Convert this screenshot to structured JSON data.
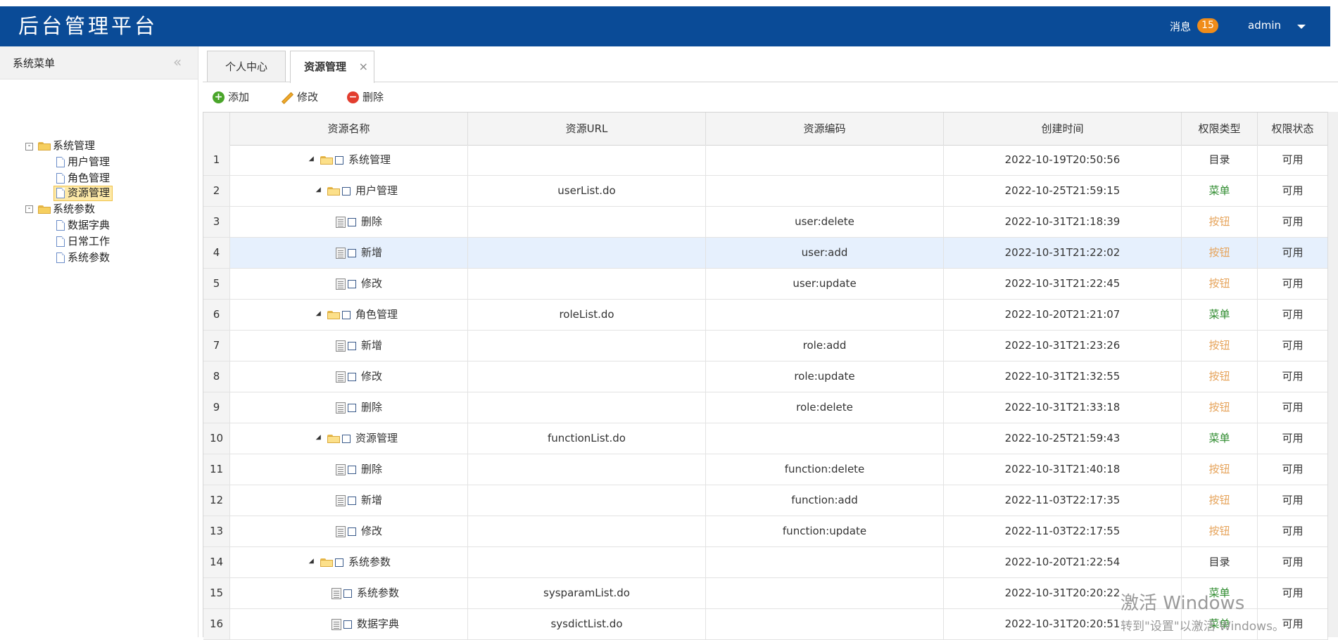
{
  "header": {
    "app_title": "后台管理平台",
    "messages_label": "消息",
    "messages_count": "15",
    "user_name": "admin"
  },
  "sidebar": {
    "title": "系统菜单",
    "tree": [
      {
        "label": "系统管理",
        "children": [
          "用户管理",
          "角色管理",
          "资源管理"
        ]
      },
      {
        "label": "系统参数",
        "children": [
          "数据字典",
          "日常工作",
          "系统参数"
        ]
      }
    ],
    "selected": "资源管理"
  },
  "tabs": [
    {
      "label": "个人中心"
    },
    {
      "label": "资源管理",
      "active": true
    }
  ],
  "toolbar": {
    "add": "添加",
    "edit": "修改",
    "delete": "删除"
  },
  "table": {
    "headers": [
      "资源名称",
      "资源URL",
      "资源编码",
      "创建时间",
      "权限类型",
      "权限状态"
    ],
    "rows": [
      {
        "n": "1",
        "level": 0,
        "kind": "dir",
        "name": "系统管理",
        "url": "",
        "code": "",
        "time": "2022-10-19T20:50:56",
        "type": "目录",
        "status": "可用"
      },
      {
        "n": "2",
        "level": 1,
        "kind": "dir",
        "name": "用户管理",
        "url": "userList.do",
        "code": "",
        "time": "2022-10-25T21:59:15",
        "type": "菜单",
        "status": "可用"
      },
      {
        "n": "3",
        "level": 2,
        "kind": "leaf",
        "name": "删除",
        "url": "",
        "code": "user:delete",
        "time": "2022-10-31T21:18:39",
        "type": "按钮",
        "status": "可用"
      },
      {
        "n": "4",
        "level": 2,
        "kind": "leaf",
        "name": "新增",
        "url": "",
        "code": "user:add",
        "time": "2022-10-31T21:22:02",
        "type": "按钮",
        "status": "可用"
      },
      {
        "n": "5",
        "level": 2,
        "kind": "leaf",
        "name": "修改",
        "url": "",
        "code": "user:update",
        "time": "2022-10-31T21:22:45",
        "type": "按钮",
        "status": "可用"
      },
      {
        "n": "6",
        "level": 1,
        "kind": "dir",
        "name": "角色管理",
        "url": "roleList.do",
        "code": "",
        "time": "2022-10-20T21:21:07",
        "type": "菜单",
        "status": "可用"
      },
      {
        "n": "7",
        "level": 2,
        "kind": "leaf",
        "name": "新增",
        "url": "",
        "code": "role:add",
        "time": "2022-10-31T21:23:26",
        "type": "按钮",
        "status": "可用"
      },
      {
        "n": "8",
        "level": 2,
        "kind": "leaf",
        "name": "修改",
        "url": "",
        "code": "role:update",
        "time": "2022-10-31T21:32:55",
        "type": "按钮",
        "status": "可用"
      },
      {
        "n": "9",
        "level": 2,
        "kind": "leaf",
        "name": "删除",
        "url": "",
        "code": "role:delete",
        "time": "2022-10-31T21:33:18",
        "type": "按钮",
        "status": "可用"
      },
      {
        "n": "10",
        "level": 1,
        "kind": "dir",
        "name": "资源管理",
        "url": "functionList.do",
        "code": "",
        "time": "2022-10-25T21:59:43",
        "type": "菜单",
        "status": "可用"
      },
      {
        "n": "11",
        "level": 2,
        "kind": "leaf",
        "name": "删除",
        "url": "",
        "code": "function:delete",
        "time": "2022-10-31T21:40:18",
        "type": "按钮",
        "status": "可用"
      },
      {
        "n": "12",
        "level": 2,
        "kind": "leaf",
        "name": "新增",
        "url": "",
        "code": "function:add",
        "time": "2022-11-03T22:17:35",
        "type": "按钮",
        "status": "可用"
      },
      {
        "n": "13",
        "level": 2,
        "kind": "leaf",
        "name": "修改",
        "url": "",
        "code": "function:update",
        "time": "2022-11-03T22:17:55",
        "type": "按钮",
        "status": "可用"
      },
      {
        "n": "14",
        "level": 0,
        "kind": "dir",
        "name": "系统参数",
        "url": "",
        "code": "",
        "time": "2022-10-20T21:22:54",
        "type": "目录",
        "status": "可用"
      },
      {
        "n": "15",
        "level": 1,
        "kind": "leaf",
        "name": "系统参数",
        "url": "sysparamList.do",
        "code": "",
        "time": "2022-10-31T20:20:22",
        "type": "菜单",
        "status": "可用"
      },
      {
        "n": "16",
        "level": 1,
        "kind": "leaf",
        "name": "数据字典",
        "url": "sysdictList.do",
        "code": "",
        "time": "2022-10-31T20:20:51",
        "type": "菜单",
        "status": "可用"
      }
    ],
    "highlighted_row": "4"
  },
  "watermark": {
    "line1": "激活 Windows",
    "line2": "转到\"设置\"以激活 Windows。"
  },
  "colors": {
    "header": "#0a4b97",
    "badge": "#f08c1a",
    "menu_type": "#2e8b2e",
    "button_type": "#e6a35a",
    "row_highlight": "#e6f0fd"
  }
}
